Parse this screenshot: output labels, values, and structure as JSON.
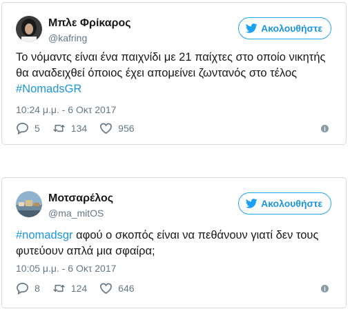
{
  "tweets": [
    {
      "name": "Μπλε Φρίκαρος",
      "handle": "@kafring",
      "follow_label": "Ακολουθήστε",
      "text_before": "Το νόμαντς είναι ένα παιχνίδι με 21 παίχτες στο οποίο νικητής θα αναδειχθεί όποιος έχει απομείνει ζωντανός στο τέλος",
      "text_hashtag": "#NomadsGR",
      "text_after": "",
      "timestamp": "10:24 μ.μ. - 6 Οκτ 2017",
      "replies": "5",
      "retweets": "134",
      "likes": "956"
    },
    {
      "name": "Μοτσαρέλος",
      "handle": "@ma_mitOS",
      "follow_label": "Ακολουθήστε",
      "text_before": "",
      "text_hashtag": "#nomadsgr",
      "text_after": " αφού ο σκοπός είναι να πεθάνουν γιατί δεν τους φυτεύουν απλά μια σφαίρα;",
      "timestamp": "10:05 μ.μ. - 6 Οκτ 2017",
      "replies": "8",
      "retweets": "124",
      "likes": "646"
    }
  ],
  "colors": {
    "accent": "#1da1f2",
    "hashtag": "#1b95e0",
    "muted": "#657786",
    "border": "#d4dbe1"
  },
  "icons": [
    "twitter-bird-icon",
    "reply-icon",
    "retweet-icon",
    "like-icon",
    "info-icon"
  ]
}
